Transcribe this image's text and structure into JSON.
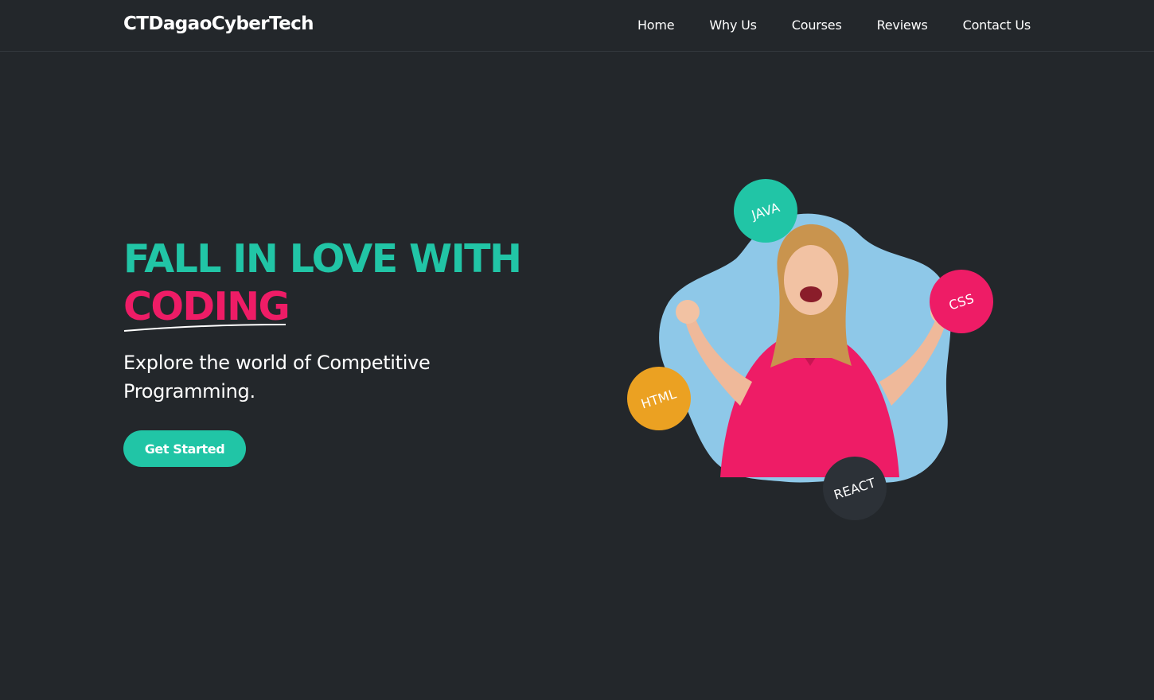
{
  "brand": {
    "name": "CTDagaoCyberTech"
  },
  "nav": {
    "items": [
      {
        "label": "Home"
      },
      {
        "label": "Why Us"
      },
      {
        "label": "Courses"
      },
      {
        "label": "Reviews"
      },
      {
        "label": "Contact Us"
      }
    ]
  },
  "hero": {
    "title_line1": "FALL IN LOVE WITH",
    "title_line2": "CODING",
    "subtitle": "Explore the world of Competitive Programming.",
    "cta_label": "Get Started"
  },
  "badges": {
    "java": "JAVA",
    "css": "CSS",
    "html": "HTML",
    "react": "REACT"
  },
  "colors": {
    "background": "#23272b",
    "accent_teal": "#21c5a6",
    "accent_pink": "#ee1c66",
    "accent_orange": "#eba122",
    "badge_dark": "#2c3137",
    "blob_blue": "#8ec8e8"
  }
}
